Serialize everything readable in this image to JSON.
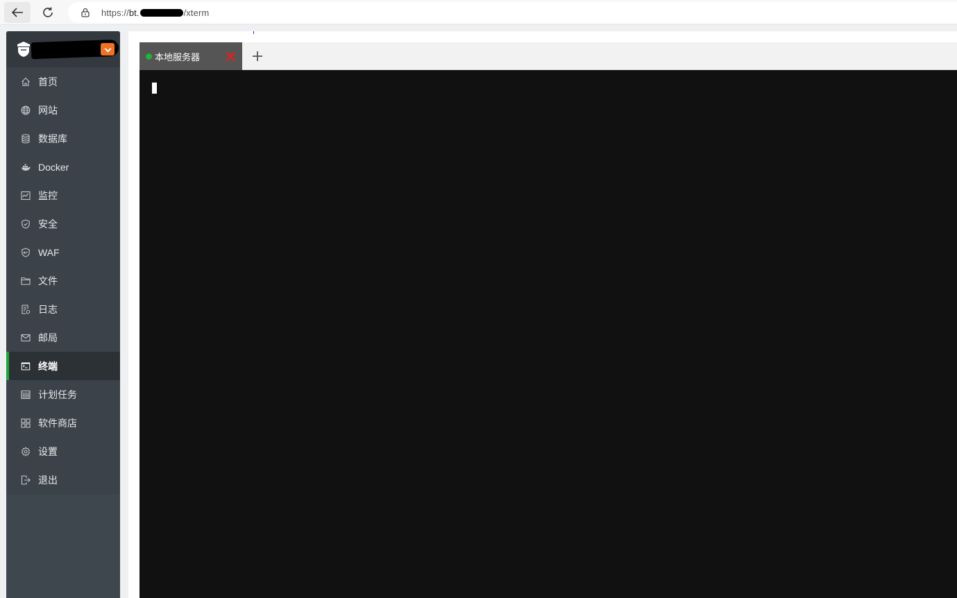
{
  "browser": {
    "url_prefix": "https://",
    "url_host": "bt.",
    "url_path": "/xterm"
  },
  "sidebar": {
    "items": [
      {
        "label": "首页",
        "icon": "home-icon"
      },
      {
        "label": "网站",
        "icon": "globe-icon"
      },
      {
        "label": "数据库",
        "icon": "database-icon"
      },
      {
        "label": "Docker",
        "icon": "docker-icon"
      },
      {
        "label": "监控",
        "icon": "monitor-icon"
      },
      {
        "label": "安全",
        "icon": "shield-icon"
      },
      {
        "label": "WAF",
        "icon": "waf-shield-icon"
      },
      {
        "label": "文件",
        "icon": "folder-icon"
      },
      {
        "label": "日志",
        "icon": "log-icon"
      },
      {
        "label": "邮局",
        "icon": "mail-icon"
      },
      {
        "label": "终端",
        "icon": "terminal-icon",
        "active": true
      },
      {
        "label": "计划任务",
        "icon": "calendar-icon"
      },
      {
        "label": "软件商店",
        "icon": "apps-icon"
      },
      {
        "label": "设置",
        "icon": "gear-icon"
      },
      {
        "label": "退出",
        "icon": "logout-icon"
      }
    ]
  },
  "terminal": {
    "tabs": [
      {
        "label": "本地服务器",
        "status": "connected"
      }
    ]
  },
  "colors": {
    "sidebar_bg": "#3b4249",
    "active_accent": "#20a53a",
    "badge": "#ef7320",
    "terminal_bg": "#111111",
    "status_connected": "#20b33a",
    "close_red": "#e02020"
  }
}
